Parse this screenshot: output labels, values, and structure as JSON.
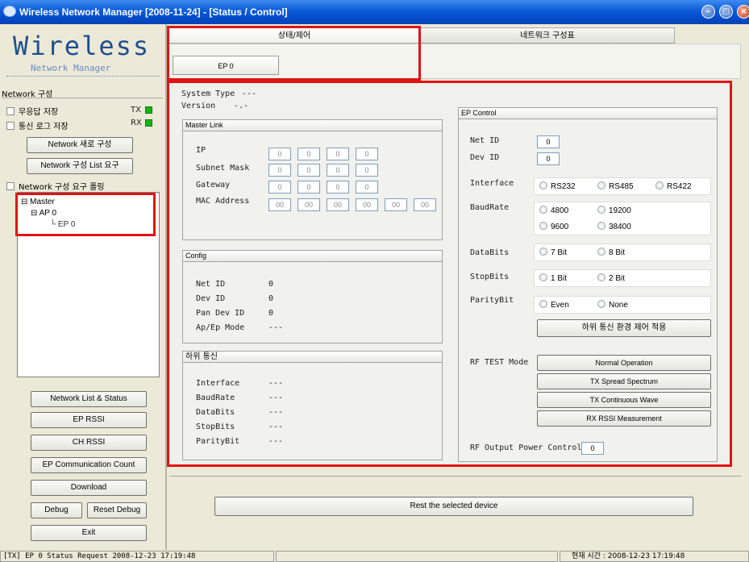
{
  "window": {
    "title": "Wireless Network Manager [2008-11-24] - [Status / Control]"
  },
  "logo": {
    "big": "Wireless",
    "small": "Network Manager"
  },
  "left": {
    "group_title": "Network 구성",
    "chk_save_reply": "무응답 저장",
    "chk_save_log": "통신 로그 저장",
    "tx_label": "TX",
    "rx_label": "RX",
    "btn_new_network": "Network 새로 구성",
    "btn_list_request": "Network 구성 List 요구",
    "chk_polling": "Network 구성 요구 폴링",
    "tree": {
      "root": "Master",
      "ap": "AP 0",
      "ep": "EP 0"
    },
    "btn_list_status": "Network List & Status",
    "btn_ep_rssi": "EP RSSI",
    "btn_ch_rssi": "CH RSSI",
    "btn_ep_count": "EP Communication Count",
    "btn_download": "Download",
    "btn_debug": "Debug",
    "btn_reset_debug": "Reset Debug",
    "btn_exit": "Exit"
  },
  "tabs": {
    "status_control": "상태/제어",
    "network_table": "네트워크 구성표",
    "ep_tab": "EP 0"
  },
  "sys": {
    "type_label": "System Type",
    "type_value": "---",
    "version_label": "Version",
    "version_value": "-.-"
  },
  "master_link": {
    "title": "Master Link",
    "ip_label": "IP",
    "subnet_label": "Subnet Mask",
    "gateway_label": "Gateway",
    "mac_label": "MAC Address",
    "ip": [
      "0",
      "0",
      "0",
      "0"
    ],
    "subnet": [
      "0",
      "0",
      "0",
      "0"
    ],
    "gateway": [
      "0",
      "0",
      "0",
      "0"
    ],
    "mac": [
      "00",
      "00",
      "00",
      "00",
      "00",
      "00"
    ]
  },
  "config": {
    "title": "Config",
    "net_id_label": "Net ID",
    "net_id": "0",
    "dev_id_label": "Dev ID",
    "dev_id": "0",
    "pan_label": "Pan Dev ID",
    "pan": "0",
    "mode_label": "Ap/Ep Mode",
    "mode": "---"
  },
  "sub_comm": {
    "title": "하위 통신",
    "interface_label": "Interface",
    "interface": "---",
    "baud_label": "BaudRate",
    "baud": "---",
    "databits_label": "DataBits",
    "databits": "---",
    "stopbits_label": "StopBits",
    "stopbits": "---",
    "parity_label": "ParityBit",
    "parity": "---"
  },
  "ep_control": {
    "title": "EP Control",
    "net_id_label": "Net ID",
    "net_id": "0",
    "dev_id_label": "Dev ID",
    "dev_id": "0",
    "interface_label": "Interface",
    "interface_opts": [
      "RS232",
      "RS485",
      "RS422"
    ],
    "baud_label": "BaudRate",
    "baud_opts": [
      "4800",
      "19200",
      "9600",
      "38400"
    ],
    "databits_label": "DataBits",
    "databits_opts": [
      "7 Bit",
      "8 Bit"
    ],
    "stopbits_label": "StopBits",
    "stopbits_opts": [
      "1 Bit",
      "2 Bit"
    ],
    "parity_label": "ParityBit",
    "parity_opts": [
      "Even",
      "None"
    ],
    "apply_btn": "하위 통신 환경 제어 적용",
    "rf_mode_label": "RF TEST Mode",
    "rf_buttons": [
      "Normal Operation",
      "TX Spread Spectrum",
      "TX Continuous Wave",
      "RX RSSI Measurement"
    ],
    "rf_power_label": "RF Output Power Control",
    "rf_power_value": "0"
  },
  "reset_btn": "Rest the selected device",
  "status": {
    "left": "[TX] EP 0  Status Request 2008-12-23 17:19:48",
    "right": "현재 시간 : 2008-12-23 17:19:48"
  },
  "colors": {
    "accent_red": "#e01414",
    "led_green": "#12b712"
  }
}
